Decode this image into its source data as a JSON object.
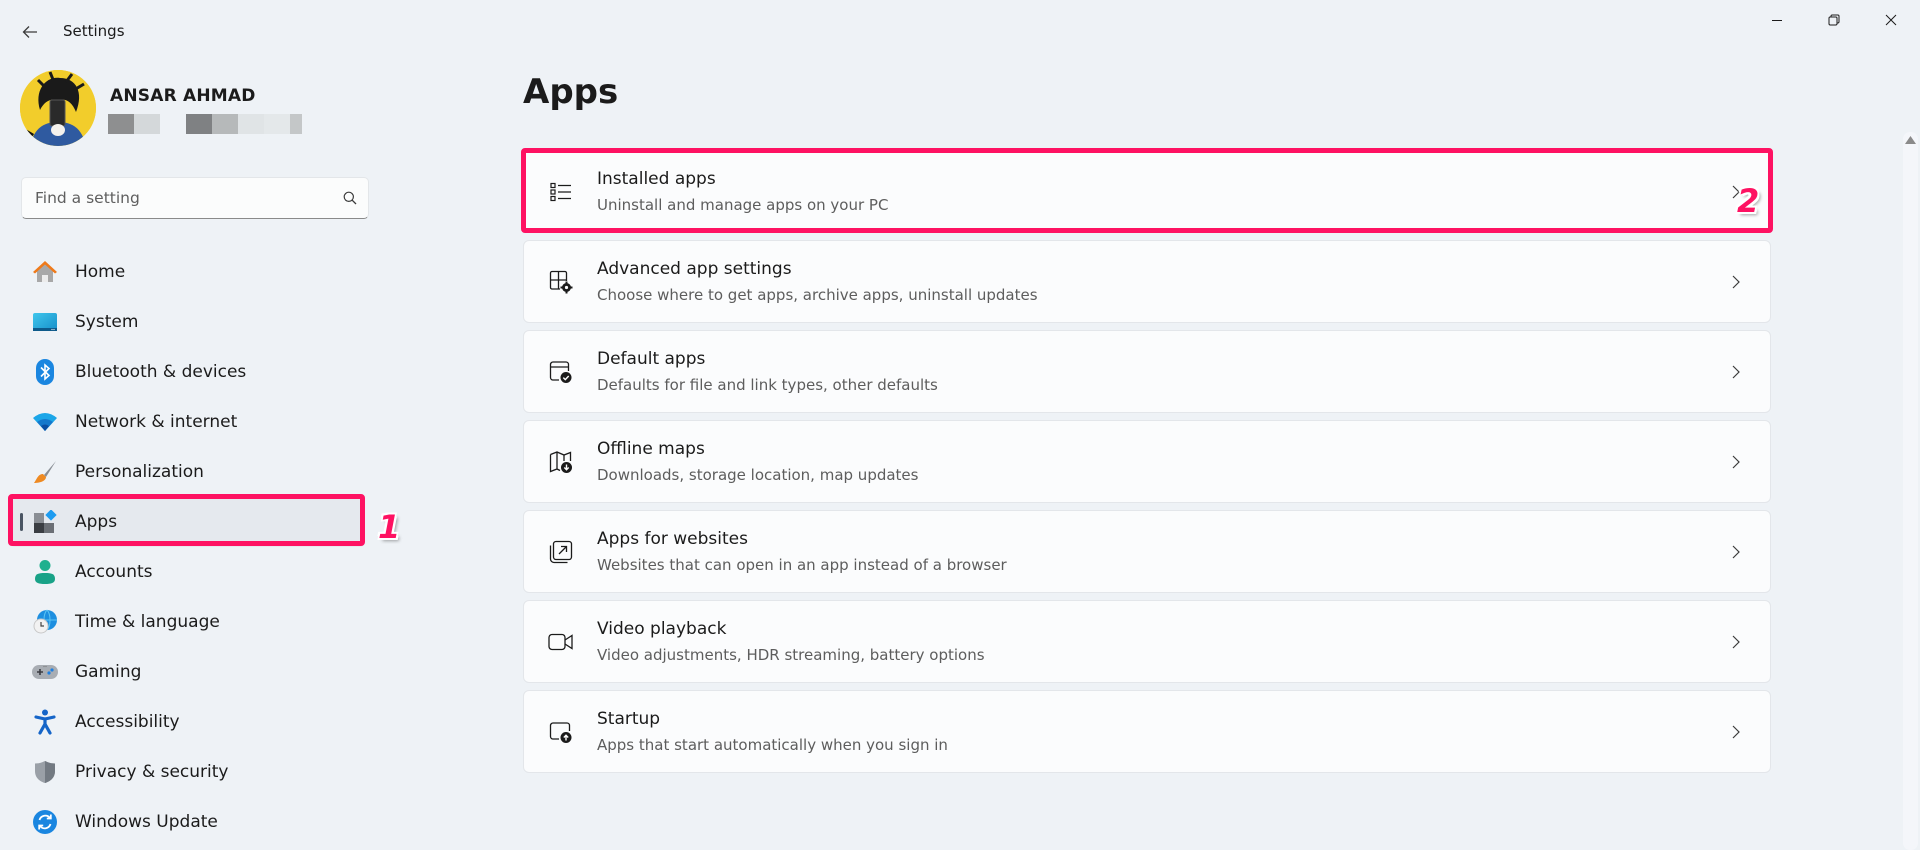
{
  "window": {
    "title": "Settings",
    "back_icon": "arrow-left-icon",
    "controls": {
      "minimize_icon": "minimize-icon",
      "maximize_icon": "restore-icon",
      "close_icon": "close-icon"
    }
  },
  "profile": {
    "name": "ANSAR AHMAD",
    "email_redacted": true
  },
  "search": {
    "placeholder": "Find a setting",
    "value": "",
    "icon": "search-icon"
  },
  "sidebar": {
    "items": [
      {
        "label": "Home",
        "icon": "home-icon",
        "selected": false
      },
      {
        "label": "System",
        "icon": "system-display-icon",
        "selected": false
      },
      {
        "label": "Bluetooth & devices",
        "icon": "bluetooth-icon",
        "selected": false
      },
      {
        "label": "Network & internet",
        "icon": "wifi-icon",
        "selected": false
      },
      {
        "label": "Personalization",
        "icon": "paintbrush-icon",
        "selected": false
      },
      {
        "label": "Apps",
        "icon": "apps-icon",
        "selected": true
      },
      {
        "label": "Accounts",
        "icon": "person-icon",
        "selected": false
      },
      {
        "label": "Time & language",
        "icon": "globe-clock-icon",
        "selected": false
      },
      {
        "label": "Gaming",
        "icon": "gamepad-icon",
        "selected": false
      },
      {
        "label": "Accessibility",
        "icon": "accessibility-icon",
        "selected": false
      },
      {
        "label": "Privacy & security",
        "icon": "shield-icon",
        "selected": false
      },
      {
        "label": "Windows Update",
        "icon": "update-sync-icon",
        "selected": false
      }
    ]
  },
  "main": {
    "title": "Apps",
    "cards": [
      {
        "title": "Installed apps",
        "description": "Uninstall and manage apps on your PC",
        "icon": "list-icon"
      },
      {
        "title": "Advanced app settings",
        "description": "Choose where to get apps, archive apps, uninstall updates",
        "icon": "app-settings-gear-icon"
      },
      {
        "title": "Default apps",
        "description": "Defaults for file and link types, other defaults",
        "icon": "default-apps-check-icon"
      },
      {
        "title": "Offline maps",
        "description": "Downloads, storage location, map updates",
        "icon": "map-download-icon"
      },
      {
        "title": "Apps for websites",
        "description": "Websites that can open in an app instead of a browser",
        "icon": "open-external-icon"
      },
      {
        "title": "Video playback",
        "description": "Video adjustments, HDR streaming, battery options",
        "icon": "video-camera-icon"
      },
      {
        "title": "Startup",
        "description": "Apps that start automatically when you sign in",
        "icon": "startup-arrow-icon"
      }
    ]
  },
  "annotations": [
    {
      "label": "1",
      "target": "Apps (sidebar)"
    },
    {
      "label": "2",
      "target": "Installed apps"
    }
  ],
  "colors": {
    "background": "#eef2f6",
    "card": "#fbfcfd",
    "annotation": "#fe1262",
    "selected_nav": "#e5e9ee"
  }
}
